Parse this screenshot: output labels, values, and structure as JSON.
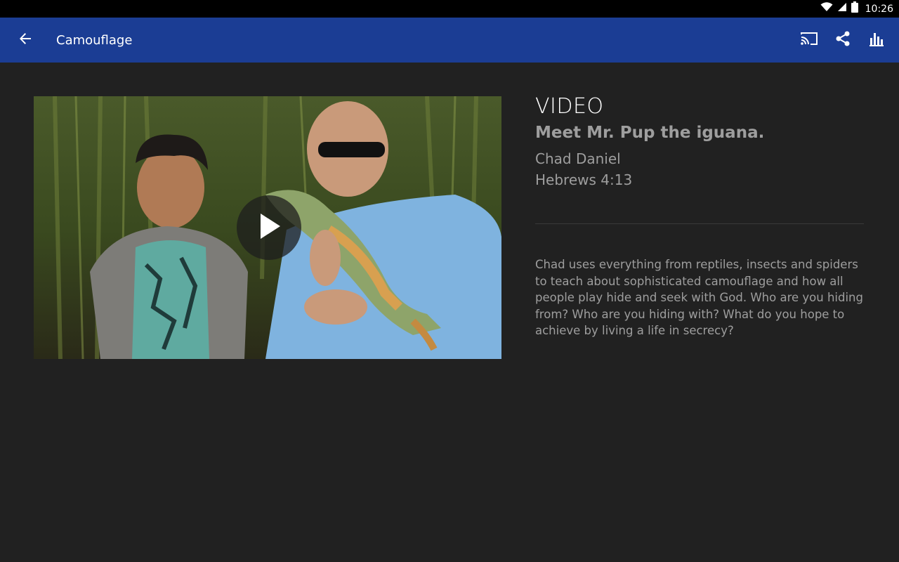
{
  "status_bar": {
    "time": "10:26",
    "icons": [
      "wifi-icon",
      "cell-signal-icon",
      "battery-icon"
    ]
  },
  "app_bar": {
    "title": "Camouflage",
    "back_icon": "arrow-left-icon",
    "actions": [
      "cast-icon",
      "share-icon",
      "stats-icon"
    ],
    "background": "#1b3d94"
  },
  "media": {
    "type_label": "VIDEO",
    "title": "Meet Mr. Pup the iguana.",
    "speaker": "Chad Daniel",
    "scripture": "Hebrews 4:13",
    "description": "Chad uses everything from reptiles, insects and spiders to teach about sophisticated camouflage and how all people play hide and seek with God. Who are you hiding from? Who are you hiding with? What do you hope to achieve by living a life in secrecy?",
    "play_icon": "play-icon"
  },
  "colors": {
    "background": "#212121",
    "text_primary": "#ffffff",
    "text_secondary": "#9e9e9e"
  }
}
